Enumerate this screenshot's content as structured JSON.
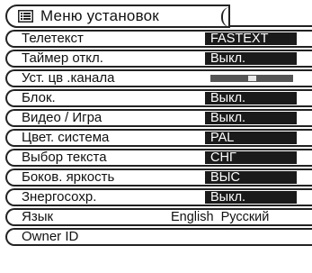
{
  "menu_title": "Меню установок",
  "items": [
    {
      "label": "Телетекст",
      "value": "FASTEXT"
    },
    {
      "label": "Таймер откл.",
      "value": "Выкл."
    },
    {
      "label": "Уст. цв .канала",
      "slider": 0.5
    },
    {
      "label": "Блок.",
      "value": "Выкл."
    },
    {
      "label": "Видео / Игра",
      "value": "Выкл."
    },
    {
      "label": "Цвет. система",
      "value": "PAL"
    },
    {
      "label": "Выбор текста",
      "value": "СНГ"
    },
    {
      "label": "Боков. яркость",
      "value": "ВЫС"
    },
    {
      "label": "Знергосохр.",
      "value": "Выкл."
    },
    {
      "label": "Язык",
      "options": [
        "English",
        "Русский"
      ]
    },
    {
      "label": "Owner ID"
    }
  ]
}
